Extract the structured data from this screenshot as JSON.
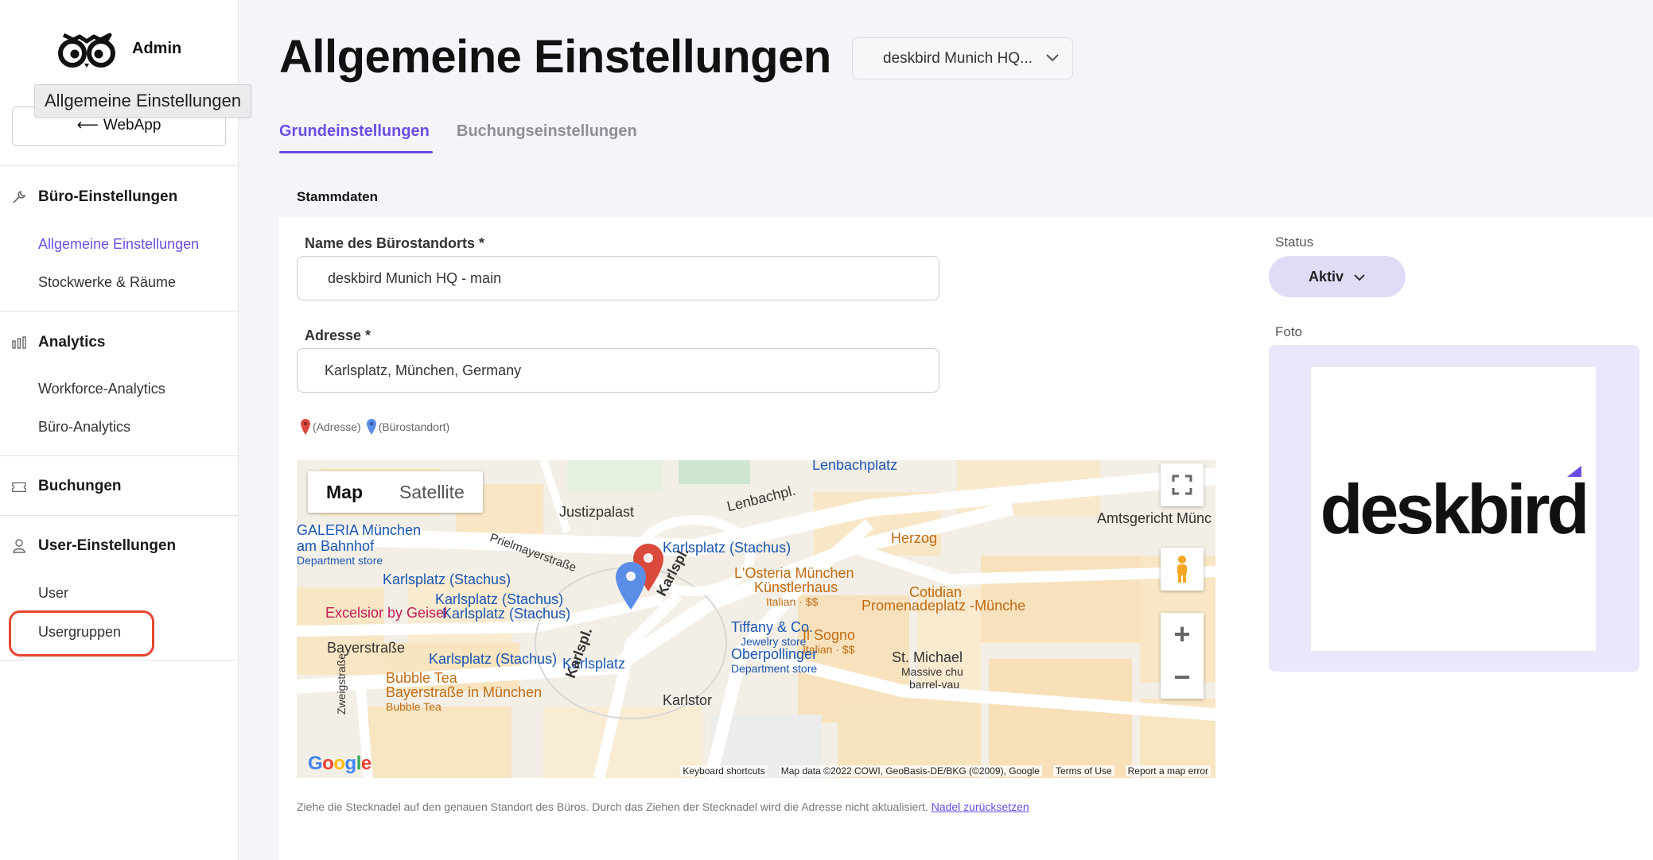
{
  "sidebar": {
    "brand": "Admin",
    "tooltip": "Allgemeine Einstellungen",
    "webapp_button": "WebApp",
    "sections": [
      {
        "label": "Büro-Einstellungen",
        "icon": "wrench-icon",
        "items": [
          "Allgemeine Einstellungen",
          "Stockwerke & Räume"
        ]
      },
      {
        "label": "Analytics",
        "icon": "bar-chart-icon",
        "items": [
          "Workforce-Analytics",
          "Büro-Analytics"
        ]
      },
      {
        "label": "Buchungen",
        "icon": "ticket-icon",
        "items": []
      },
      {
        "label": "User-Einstellungen",
        "icon": "user-icon",
        "items": [
          "User",
          "Usergruppen"
        ]
      }
    ],
    "active_item": "Allgemeine Einstellungen",
    "highlighted_item": "Usergruppen"
  },
  "header": {
    "title": "Allgemeine Einstellungen",
    "site_select": "deskbird Munich HQ...",
    "tabs": [
      {
        "label": "Grundeinstellungen",
        "active": true
      },
      {
        "label": "Buchungseinstellungen",
        "active": false
      }
    ]
  },
  "form": {
    "section_title": "Stammdaten",
    "name_label": "Name des Bürostandorts *",
    "name_value": "deskbird Munich HQ - main",
    "address_label": "Adresse *",
    "address_value": "Karlsplatz, München, Germany",
    "legend_address": "(Adresse)",
    "legend_office": "(Bürostandort)",
    "hint_text": "Ziehe die Stecknadel auf den genauen Standort des Büros. Durch das Ziehen der Stecknadel wird die Adresse nicht aktualisiert.",
    "hint_link": "Nadel zurücksetzen"
  },
  "map": {
    "type_map": "Map",
    "type_satellite": "Satellite",
    "labels": {
      "justizpalast": "Justizpalast",
      "lenbachplatz": "Lenbachplatz",
      "lenbachpl": "Lenbachpl.",
      "amtsgericht": "Amtsgericht Münc",
      "galeria1": "GALERIA München",
      "galeria2": "am Bahnhof",
      "galeria3": "Department store",
      "prielmayerstrasse": "Prielmayerstraße",
      "karlsplatz_u": "Karlsplatz (Stachus)",
      "karlspl": "Karlspl.",
      "osteria1": "L'Osteria München",
      "osteria2": "Künstlerhaus",
      "osteria3": "Italian · $$",
      "herzog": "Herzog",
      "cotidiano": "Cotidian",
      "promenadeplatz": "Promenadeplatz -Münche",
      "karlsplatz_stachus_1": "Karlsplatz (Stachus)",
      "karlsplatz_stachus_2": "Karlsplatz (Stachus)",
      "karlsplatz_stachus_3": "Karlsplatz (Stachus)",
      "excelsior": "Excelsior by Geisel",
      "tiffany1": "Tiffany & Co.",
      "tiffany2": "Jewelry store",
      "ilsogno1": "Il Sogno",
      "ilsogno2": "Italian · $$",
      "bayerstrasse": "Bayerstraße",
      "karlsplatz_stachus_4": "Karlsplatz (Stachus)",
      "karlsplatz_s": "Karlsplatz",
      "oberpollinger1": "Oberpollinger",
      "oberpollinger2": "Department store",
      "stmichael1": "St. Michael",
      "stmichael2": "Massive chu",
      "stmichael3": "barrel-vau",
      "bubbletea1": "Bubble Tea",
      "bubbletea2": "Bayerstraße in München",
      "bubbletea3": "Bubble Tea",
      "zweigstrasse": "Zweigstraße",
      "karlstor": "Karlstor",
      "karlspl2": "Karlspl."
    },
    "google": "Google",
    "footer": [
      "Keyboard shortcuts",
      "Map data ©2022 COWI, GeoBasis-DE/BKG (©2009), Google",
      "Terms of Use",
      "Report a map error"
    ],
    "pin_address_color": "#d94a3d",
    "pin_office_color": "#5a8de6"
  },
  "status": {
    "label": "Status",
    "value": "Aktiv"
  },
  "photo": {
    "label": "Foto",
    "logo_text": "deskbird"
  },
  "colors": {
    "accent": "#6b4ce6",
    "highlight": "#e5452f"
  }
}
